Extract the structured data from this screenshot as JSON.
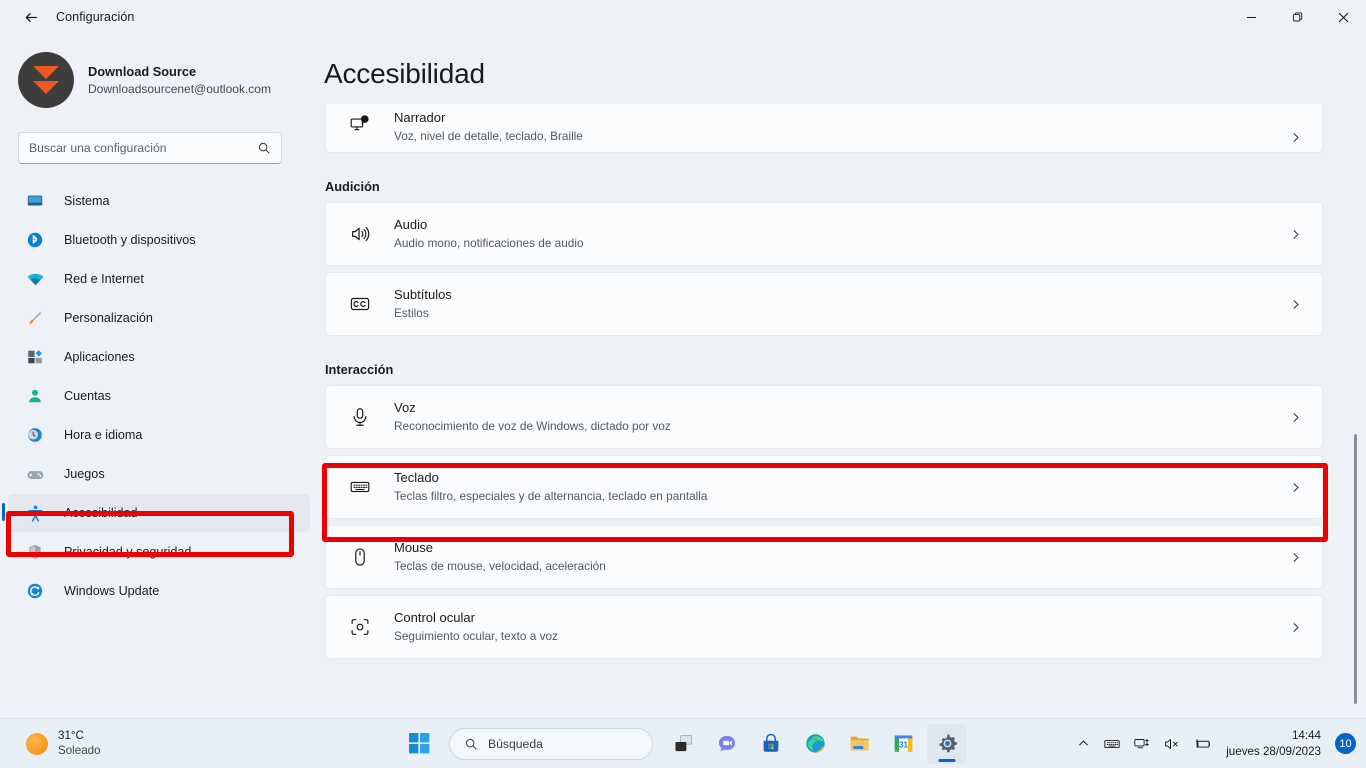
{
  "titlebar": {
    "back_icon": "arrow-left-icon",
    "title": "Configuración",
    "minimize_label": "—",
    "maximize_label": "❐",
    "close_label": "✕"
  },
  "account": {
    "name": "Download Source",
    "email": "Downloadsourcenet@outlook.com",
    "avatar_icon": "download-source-logo"
  },
  "search": {
    "placeholder": "Buscar una configuración",
    "value": "",
    "icon": "search-icon"
  },
  "sidebar": {
    "items": [
      {
        "label": "Sistema",
        "icon": "monitor-icon",
        "selected": false
      },
      {
        "label": "Bluetooth y dispositivos",
        "icon": "bluetooth-icon",
        "selected": false
      },
      {
        "label": "Red e Internet",
        "icon": "wifi-icon",
        "selected": false
      },
      {
        "label": "Personalización",
        "icon": "paintbrush-icon",
        "selected": false
      },
      {
        "label": "Aplicaciones",
        "icon": "apps-icon",
        "selected": false
      },
      {
        "label": "Cuentas",
        "icon": "person-icon",
        "selected": false
      },
      {
        "label": "Hora e idioma",
        "icon": "clock-globe-icon",
        "selected": false
      },
      {
        "label": "Juegos",
        "icon": "gamepad-icon",
        "selected": false
      },
      {
        "label": "Accesibilidad",
        "icon": "accessibility-icon",
        "selected": true
      },
      {
        "label": "Privacidad y seguridad",
        "icon": "shield-icon",
        "selected": false
      },
      {
        "label": "Windows Update",
        "icon": "update-icon",
        "selected": false
      }
    ]
  },
  "main": {
    "page_title": "Accesibilidad",
    "groups": [
      {
        "heading": "",
        "cards": [
          {
            "title": "Narrador",
            "subtitle": "Voz, nivel de detalle, teclado, Braille",
            "icon": "narrator-icon",
            "clipped": true
          }
        ]
      },
      {
        "heading": "Audición",
        "cards": [
          {
            "title": "Audio",
            "subtitle": "Audio mono, notificaciones de audio",
            "icon": "speaker-icon",
            "clipped": false
          },
          {
            "title": "Subtítulos",
            "subtitle": "Estilos",
            "icon": "closed-caption-icon",
            "clipped": false
          }
        ]
      },
      {
        "heading": "Interacción",
        "cards": [
          {
            "title": "Voz",
            "subtitle": "Reconocimiento de voz de Windows, dictado por voz",
            "icon": "microphone-icon",
            "clipped": false
          },
          {
            "title": "Teclado",
            "subtitle": "Teclas filtro, especiales y de alternancia, teclado en pantalla",
            "icon": "keyboard-icon",
            "clipped": false
          },
          {
            "title": "Mouse",
            "subtitle": "Teclas de mouse, velocidad, aceleración",
            "icon": "mouse-icon",
            "clipped": false
          },
          {
            "title": "Control ocular",
            "subtitle": "Seguimiento ocular, texto a voz",
            "icon": "eye-control-icon",
            "clipped": false
          }
        ]
      }
    ]
  },
  "annotations": {
    "color": "#ee0000",
    "sidebar_target": "Accesibilidad",
    "card_target": "Teclado"
  },
  "taskbar": {
    "weather": {
      "temperature": "31°C",
      "condition": "Soleado",
      "icon": "sun-icon"
    },
    "start_icon": "windows-start-icon",
    "search": {
      "label": "Búsqueda",
      "icon": "search-icon"
    },
    "apps": [
      {
        "name": "task-view-icon"
      },
      {
        "name": "chat-icon"
      },
      {
        "name": "microsoft-store-icon"
      },
      {
        "name": "edge-icon"
      },
      {
        "name": "file-explorer-icon"
      },
      {
        "name": "calendar-icon",
        "day": "31"
      },
      {
        "name": "settings-icon",
        "active": true
      }
    ],
    "tray": {
      "overflow_icon": "chevron-up-icon",
      "ime_icon": "keyboard-icon",
      "network_icon": "network-icon",
      "volume_icon": "speaker-muted-icon",
      "battery_icon": "battery-charging-icon",
      "time": "14:44",
      "date": "jueves 28/09/2023",
      "notification_count": "10"
    }
  }
}
